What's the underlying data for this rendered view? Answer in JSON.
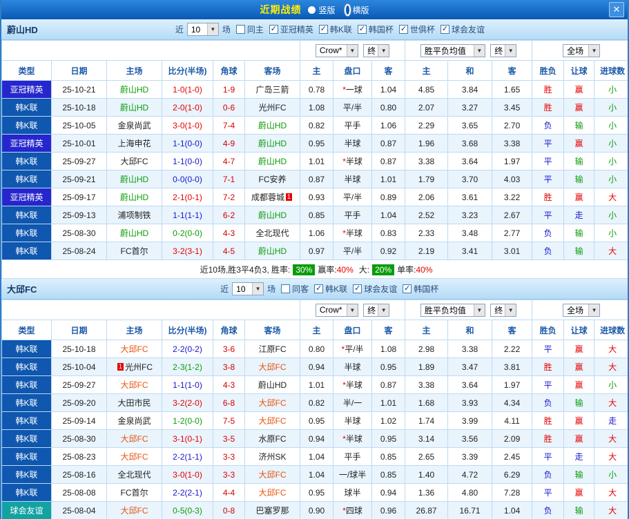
{
  "titlebar": {
    "title": "近期战绩",
    "options": [
      {
        "label": "竖版",
        "selected": false
      },
      {
        "label": "横版",
        "selected": true
      }
    ]
  },
  "icons": {
    "check": "✓",
    "arrow": "▼",
    "close": "✕"
  },
  "labels": {
    "recent": "近",
    "match_count": "10",
    "games": "场"
  },
  "dropdowns": {
    "bookmaker": "Crow*",
    "final": "终",
    "avg": "胜平负均值",
    "scope": "全场"
  },
  "table_columns": [
    "类型",
    "日期",
    "主场",
    "比分(半场)",
    "角球",
    "客场",
    "主",
    "盘口",
    "客",
    "主",
    "和",
    "客",
    "胜负",
    "让球",
    "进球数"
  ],
  "colors": {
    "title_yellow": "#ffee00",
    "topbar_blue": "#0a59b5",
    "acl_league_blue": "#2626cd",
    "k_league_blue": "#0f57af",
    "friendly_teal": "#12a2a2",
    "ulsan_green": "#0a9c0a",
    "daegu_orange": "#e8540e",
    "home_win_red": "#e60000",
    "draw_blue": "#1616cc",
    "away_win_green": "#0a9c0a",
    "rate_badge_green": "#0a9c0a"
  },
  "sections": [
    {
      "team": "蔚山HD",
      "team_class": "tm-green",
      "filters": [
        {
          "label": "同主",
          "checked": false
        },
        {
          "label": "亚冠精英",
          "checked": true
        },
        {
          "label": "韩K联",
          "checked": true
        },
        {
          "label": "韩国杯",
          "checked": true
        },
        {
          "label": "世俱杯",
          "checked": true
        },
        {
          "label": "球会友谊",
          "checked": true
        }
      ],
      "rows": [
        {
          "league": "亚冠精英",
          "date": "25-10-21",
          "home": "蔚山HD",
          "away": "广岛三箭",
          "score": "1-0(1-0)",
          "outcome": "home",
          "corner": "1-9",
          "ah": [
            "0.78",
            "*一球",
            "1.04"
          ],
          "eu": [
            "4.85",
            "3.84",
            "1.65"
          ],
          "res": [
            "胜",
            "赢",
            "小"
          ]
        },
        {
          "league": "韩K联",
          "date": "25-10-18",
          "home": "蔚山HD",
          "away": "光州FC",
          "score": "2-0(1-0)",
          "outcome": "home",
          "corner": "0-6",
          "ah": [
            "1.08",
            "平/半",
            "0.80"
          ],
          "eu": [
            "2.07",
            "3.27",
            "3.45"
          ],
          "res": [
            "胜",
            "赢",
            "小"
          ]
        },
        {
          "league": "韩K联",
          "date": "25-10-05",
          "home": "金泉尚武",
          "away": "蔚山HD",
          "score": "3-0(1-0)",
          "outcome": "home",
          "corner": "7-4",
          "ah": [
            "0.82",
            "平手",
            "1.06"
          ],
          "eu": [
            "2.29",
            "3.65",
            "2.70"
          ],
          "res": [
            "负",
            "输",
            "小"
          ]
        },
        {
          "league": "亚冠精英",
          "date": "25-10-01",
          "home": "上海申花",
          "away": "蔚山HD",
          "score": "1-1(0-0)",
          "outcome": "draw",
          "corner": "4-9",
          "ah": [
            "0.95",
            "半球",
            "0.87"
          ],
          "eu": [
            "1.96",
            "3.68",
            "3.38"
          ],
          "res": [
            "平",
            "赢",
            "小"
          ]
        },
        {
          "league": "韩K联",
          "date": "25-09-27",
          "home": "大邱FC",
          "away": "蔚山HD",
          "score": "1-1(0-0)",
          "outcome": "draw",
          "corner": "4-7",
          "ah": [
            "1.01",
            "*半球",
            "0.87"
          ],
          "eu": [
            "3.38",
            "3.64",
            "1.97"
          ],
          "res": [
            "平",
            "输",
            "小"
          ]
        },
        {
          "league": "韩K联",
          "date": "25-09-21",
          "home": "蔚山HD",
          "away": "FC安养",
          "score": "0-0(0-0)",
          "outcome": "draw",
          "corner": "7-1",
          "ah": [
            "0.87",
            "半球",
            "1.01"
          ],
          "eu": [
            "1.79",
            "3.70",
            "4.03"
          ],
          "res": [
            "平",
            "输",
            "小"
          ]
        },
        {
          "league": "亚冠精英",
          "date": "25-09-17",
          "home": "蔚山HD",
          "away": "成都蓉城",
          "abadge": "1",
          "score": "2-1(0-1)",
          "outcome": "home",
          "corner": "7-2",
          "ah": [
            "0.93",
            "平/半",
            "0.89"
          ],
          "eu": [
            "2.06",
            "3.61",
            "3.22"
          ],
          "res": [
            "胜",
            "赢",
            "大"
          ]
        },
        {
          "league": "韩K联",
          "date": "25-09-13",
          "home": "浦项制铁",
          "away": "蔚山HD",
          "score": "1-1(1-1)",
          "outcome": "draw",
          "corner": "6-2",
          "ah": [
            "0.85",
            "平手",
            "1.04"
          ],
          "eu": [
            "2.52",
            "3.23",
            "2.67"
          ],
          "res": [
            "平",
            "走",
            "小"
          ]
        },
        {
          "league": "韩K联",
          "date": "25-08-30",
          "home": "蔚山HD",
          "away": "全北现代",
          "score": "0-2(0-0)",
          "outcome": "away",
          "corner": "4-3",
          "ah": [
            "1.06",
            "*半球",
            "0.83"
          ],
          "eu": [
            "2.33",
            "3.48",
            "2.77"
          ],
          "res": [
            "负",
            "输",
            "小"
          ]
        },
        {
          "league": "韩K联",
          "date": "25-08-24",
          "home": "FC首尔",
          "away": "蔚山HD",
          "score": "3-2(3-1)",
          "outcome": "home",
          "corner": "4-5",
          "ah": [
            "0.97",
            "平/半",
            "0.92"
          ],
          "eu": [
            "2.19",
            "3.41",
            "3.01"
          ],
          "res": [
            "负",
            "输",
            "大"
          ]
        }
      ],
      "summary": {
        "prefix": "近10场,胜3平4负3, 胜率:",
        "win_rate": "30%",
        "cover_label": "赢率:",
        "cover_rate": "40%",
        "big_label": "大:",
        "big_rate": "20%",
        "odd_label": "单率:",
        "odd_rate": "40%"
      }
    },
    {
      "team": "大邱FC",
      "team_class": "tm-orange",
      "filters": [
        {
          "label": "同客",
          "checked": false
        },
        {
          "label": "韩K联",
          "checked": true
        },
        {
          "label": "球会友谊",
          "checked": true
        },
        {
          "label": "韩国杯",
          "checked": true
        }
      ],
      "rows": [
        {
          "league": "韩K联",
          "date": "25-10-18",
          "home": "大邱FC",
          "away": "江原FC",
          "score": "2-2(0-2)",
          "outcome": "draw",
          "corner": "3-6",
          "ah": [
            "0.80",
            "*平/半",
            "1.08"
          ],
          "eu": [
            "2.98",
            "3.38",
            "2.22"
          ],
          "res": [
            "平",
            "赢",
            "大"
          ]
        },
        {
          "league": "韩K联",
          "date": "25-10-04",
          "home": "光州FC",
          "hbadge": "1",
          "away": "大邱FC",
          "score": "2-3(1-2)",
          "outcome": "away",
          "corner": "3-8",
          "ah": [
            "0.94",
            "半球",
            "0.95"
          ],
          "eu": [
            "1.89",
            "3.47",
            "3.81"
          ],
          "res": [
            "胜",
            "赢",
            "大"
          ]
        },
        {
          "league": "韩K联",
          "date": "25-09-27",
          "home": "大邱FC",
          "away": "蔚山HD",
          "score": "1-1(1-0)",
          "outcome": "draw",
          "corner": "4-3",
          "ah": [
            "1.01",
            "*半球",
            "0.87"
          ],
          "eu": [
            "3.38",
            "3.64",
            "1.97"
          ],
          "res": [
            "平",
            "赢",
            "小"
          ]
        },
        {
          "league": "韩K联",
          "date": "25-09-20",
          "home": "大田市民",
          "away": "大邱FC",
          "score": "3-2(2-0)",
          "outcome": "home",
          "corner": "6-8",
          "ah": [
            "0.82",
            "半/一",
            "1.01"
          ],
          "eu": [
            "1.68",
            "3.93",
            "4.34"
          ],
          "res": [
            "负",
            "输",
            "大"
          ]
        },
        {
          "league": "韩K联",
          "date": "25-09-14",
          "home": "金泉尚武",
          "away": "大邱FC",
          "score": "1-2(0-0)",
          "outcome": "away",
          "corner": "7-5",
          "ah": [
            "0.95",
            "半球",
            "1.02"
          ],
          "eu": [
            "1.74",
            "3.99",
            "4.11"
          ],
          "res": [
            "胜",
            "赢",
            "走"
          ]
        },
        {
          "league": "韩K联",
          "date": "25-08-30",
          "home": "大邱FC",
          "away": "水原FC",
          "score": "3-1(0-1)",
          "outcome": "home",
          "corner": "3-5",
          "ah": [
            "0.94",
            "*半球",
            "0.95"
          ],
          "eu": [
            "3.14",
            "3.56",
            "2.09"
          ],
          "res": [
            "胜",
            "赢",
            "大"
          ]
        },
        {
          "league": "韩K联",
          "date": "25-08-23",
          "home": "大邱FC",
          "away": "济州SK",
          "score": "2-2(1-1)",
          "outcome": "draw",
          "corner": "3-3",
          "ah": [
            "1.04",
            "平手",
            "0.85"
          ],
          "eu": [
            "2.65",
            "3.39",
            "2.45"
          ],
          "res": [
            "平",
            "走",
            "大"
          ]
        },
        {
          "league": "韩K联",
          "date": "25-08-16",
          "home": "全北现代",
          "away": "大邱FC",
          "score": "3-0(1-0)",
          "outcome": "home",
          "corner": "3-3",
          "ah": [
            "1.04",
            "一/球半",
            "0.85"
          ],
          "eu": [
            "1.40",
            "4.72",
            "6.29"
          ],
          "res": [
            "负",
            "输",
            "小"
          ]
        },
        {
          "league": "韩K联",
          "date": "25-08-08",
          "home": "FC首尔",
          "away": "大邱FC",
          "score": "2-2(2-1)",
          "outcome": "draw",
          "corner": "4-4",
          "ah": [
            "0.95",
            "球半",
            "0.94"
          ],
          "eu": [
            "1.36",
            "4.80",
            "7.28"
          ],
          "res": [
            "平",
            "赢",
            "大"
          ]
        },
        {
          "league": "球会友谊",
          "date": "25-08-04",
          "home": "大邱FC",
          "away": "巴塞罗那",
          "score": "0-5(0-3)",
          "outcome": "away",
          "corner": "0-8",
          "ah": [
            "0.90",
            "*四球",
            "0.96"
          ],
          "eu": [
            "26.87",
            "16.71",
            "1.04"
          ],
          "res": [
            "负",
            "输",
            "大"
          ]
        }
      ]
    }
  ]
}
